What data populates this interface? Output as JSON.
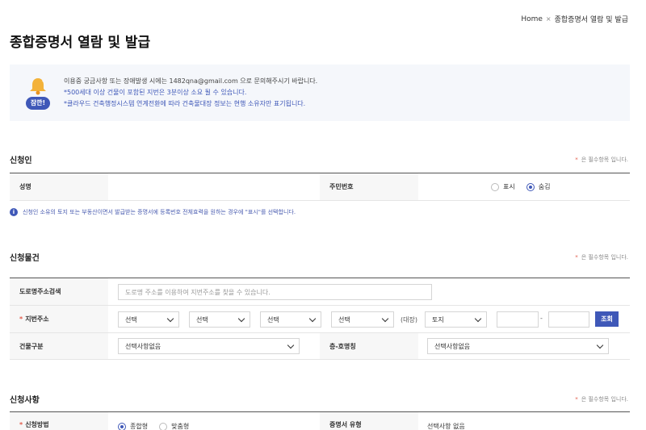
{
  "breadcrumb": {
    "home": "Home",
    "sep": "×",
    "current": "종합증명서 열람 및 발급"
  },
  "page_title": "종합증명서 열람 및 발급",
  "notice": {
    "tag": "잠깐!",
    "line1": "이용중 궁금사항 또는 장애발생 시에는 1482qna@gmail.com 으로 문의해주시기 바랍니다.",
    "line2": "*500세대 이상 건물이 포함된 지번은 3분이상 소요 될 수 있습니다.",
    "line3": "*클라우드 건축행정시스템 연계전환에 따라 건축물대장 정보는 현행 소유자만 표기됩니다."
  },
  "applicant": {
    "title": "신청인",
    "required_note": "은 필수항목 입니다.",
    "name_label": "성명",
    "id_label": "주민번호",
    "radio_show": "표시",
    "radio_hide": "숨김",
    "info": "신청인 소유의 토지 또는 부동산이면서 발급받는 증명서에 등록번호 전체효력을 원하는 경우에 \"표시\"를 선택합니다."
  },
  "property": {
    "title": "신청물건",
    "required_note": "은 필수항목 입니다.",
    "road_label": "도로명주소검색",
    "road_placeholder": "도로명 주소를 이용하여 지번주소를 찾을 수 있습니다.",
    "jibun_label": "지번주소",
    "select1": "선택",
    "select2": "선택",
    "select3": "선택",
    "select4": "선택",
    "daejang": "(대장)",
    "land_select": "토지",
    "dash": "-",
    "search_button": "조회",
    "building_label": "건물구분",
    "building_select": "선택사항없음",
    "floor_label": "층-호명칭",
    "floor_select": "선택사항없음"
  },
  "request": {
    "title": "신청사항",
    "required_note": "은 필수항목 입니다.",
    "method_label": "신청방법",
    "radio_combined": "종합형",
    "radio_custom": "맞춤형",
    "cert_label": "증명서 유형",
    "cert_value": "선택사항 없음"
  }
}
